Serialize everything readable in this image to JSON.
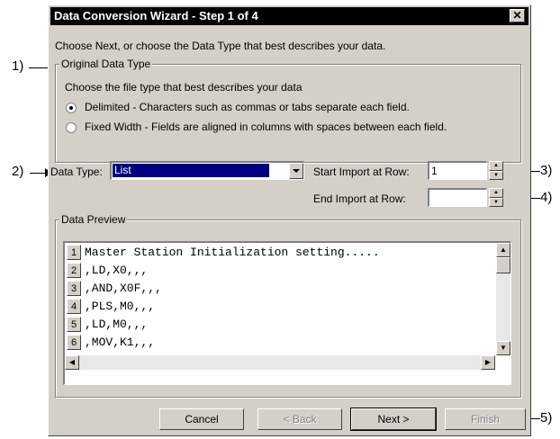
{
  "window": {
    "title": "Data Conversion Wizard - Step 1 of 4",
    "close_glyph": "✕"
  },
  "intro_text": "Choose Next, or choose the Data Type that best describes your data.",
  "original_data_type": {
    "legend": "Original Data Type",
    "prompt": "Choose the file type that best describes your data",
    "options": [
      {
        "label": "Delimited - Characters such as commas or tabs separate each field.",
        "selected": true
      },
      {
        "label": "Fixed Width - Fields are aligned in columns with spaces between each field.",
        "selected": false
      }
    ]
  },
  "data_type": {
    "label": "Data Type:",
    "value": "List"
  },
  "start_import": {
    "label": "Start Import at Row:",
    "value": "1"
  },
  "end_import": {
    "label": "End Import at Row:",
    "value": ""
  },
  "preview": {
    "legend": "Data Preview",
    "rows": [
      {
        "num": "1",
        "text": "Master Station Initialization setting....."
      },
      {
        "num": "2",
        "text": ",LD,X0,,,"
      },
      {
        "num": "3",
        "text": ",AND,X0F,,,"
      },
      {
        "num": "4",
        "text": ",PLS,M0,,,"
      },
      {
        "num": "5",
        "text": ",LD,M0,,,"
      },
      {
        "num": "6",
        "text": ",MOV,K1,,,"
      }
    ]
  },
  "buttons": {
    "cancel": "Cancel",
    "back": "< Back",
    "next": "Next >",
    "finish": "Finish"
  },
  "callouts": {
    "c1": "1)",
    "c2": "2)",
    "c3": "3)",
    "c4": "4)",
    "c5": "5)"
  }
}
